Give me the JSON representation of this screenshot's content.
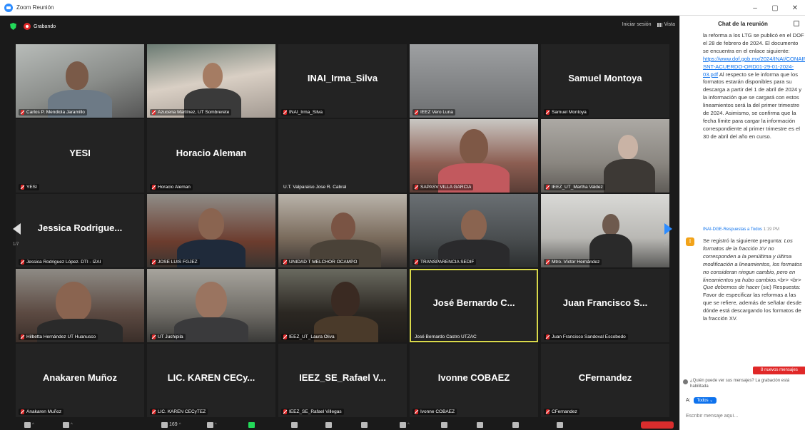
{
  "window": {
    "title": "Zoom Reunión",
    "controls": [
      "–",
      "▢",
      "✕"
    ]
  },
  "topbar": {
    "recording_label": "Grabando",
    "signin_label": "Iniciar sesión",
    "view_label": "Vista"
  },
  "gallery": {
    "page_left": "1/7",
    "page_right": "1/7",
    "tiles": [
      {
        "name": "Carlos P. Mendiola Jaramillo",
        "big": "",
        "video": true
      },
      {
        "name": "Azucena Martínez, UT Sombrerete",
        "big": "",
        "video": true
      },
      {
        "name": "INAI_Irma_Silva",
        "big": "INAI_Irma_Silva",
        "video": false
      },
      {
        "name": "IEEZ Vero Luna",
        "big": "",
        "video": true
      },
      {
        "name": "Samuel Montoya",
        "big": "Samuel Montoya",
        "video": false
      },
      {
        "name": "YESI",
        "big": "YESI",
        "video": false
      },
      {
        "name": "Horacio Aleman",
        "big": "Horacio Aleman",
        "video": false
      },
      {
        "name": "U.T. Valparaiso Jose R. Cabral",
        "big": "",
        "video": false
      },
      {
        "name": "SAPASV VILLA GARCIA",
        "big": "",
        "video": true
      },
      {
        "name": "IEEZ_UT_Martha Valdez",
        "big": "",
        "video": true
      },
      {
        "name": "Jessica Rodriguez López. DTI - IZAI",
        "big": "Jessica Rodrigue...",
        "video": false
      },
      {
        "name": "JOSÉ LUIS FGJEZ",
        "big": "",
        "video": true
      },
      {
        "name": "UNIDAD T MELCHOR OCAMPO",
        "big": "",
        "video": true
      },
      {
        "name": "TRANSPARENCIA SEDIF",
        "big": "",
        "video": true
      },
      {
        "name": "Mtro. Víctor Hernández",
        "big": "",
        "video": true
      },
      {
        "name": "Hilbetta Hernández UT Huanusco",
        "big": "",
        "video": true
      },
      {
        "name": "UT Juchipila",
        "big": "",
        "video": true
      },
      {
        "name": "IEEZ_UT_Laura Oliva",
        "big": "",
        "video": true
      },
      {
        "name": "José Bernardo Castro UTZAC",
        "big": "José Bernardo C...",
        "video": false
      },
      {
        "name": "Juan Francisco Sandoval Escobedo",
        "big": "Juan Francisco S...",
        "video": false
      },
      {
        "name": "Anakaren Muñoz",
        "big": "Anakaren Muñoz",
        "video": false
      },
      {
        "name": "LIC. KAREN CECyTEZ",
        "big": "LIC. KAREN CECy...",
        "video": false
      },
      {
        "name": "IEEZ_SE_Rafael Villegas",
        "big": "IEEZ_SE_Rafael V...",
        "video": false
      },
      {
        "name": "Ivonne COBAEZ",
        "big": "Ivonne COBAEZ",
        "video": false
      },
      {
        "name": "CFernandez",
        "big": "CFernandez",
        "video": false
      }
    ]
  },
  "toolbar": {
    "participants_count": "169"
  },
  "chat": {
    "header": "Chat de la reunión",
    "msg1_text_a": "la reforma a los LTG se publicó en el DOF el 28 de febrero de 2024. El documento se encuentra en el enlace siguiente:",
    "msg1_link": "https://www.dof.gob.mx/2024/INAI/CONAIP-SNT-ACUERDO-ORD01-29-01-2024-03.pdf",
    "msg1_text_b": "Al respecto se le informa que los formatos estarán disponibles para su descarga a partir del 1 de abril de 2024 y la información que se cargará con estos lineamientos será la del primer trimestre de 2024. Asimismo, se confirma que la fecha límite para cargar la información correspondiente al primer trimestre es el 30 de abril del año en curso.",
    "msg2_sender": "INAI-DGE-Respuestas a Todos",
    "msg2_time": "1:19 PM",
    "msg2_avatar": "I",
    "msg2_text_a": "Se registró la siguiente pregunta:",
    "msg2_text_italic": "Los formatos de la fracción XV no corresponden a la penúltima y última modificación a lineamientos, los formatos no consideran ningun cambio, pero en lineamientos ya hubo cambios.<br> <br> Que debemos de hacer",
    "msg2_text_b": "(sic) Respuesta: Favor de especificar las reformas a las que se refiere, además de señalar desde dónde está descargando los formatos de la fracción XV.",
    "new_messages": "8 nuevos mensajes",
    "who_can_see": "¿Quién puede ver sus mensajes? La grabación está habilitada",
    "to_label": "A:",
    "to_value": "Todos",
    "input_placeholder": "Escribir mensaje aquí..."
  }
}
